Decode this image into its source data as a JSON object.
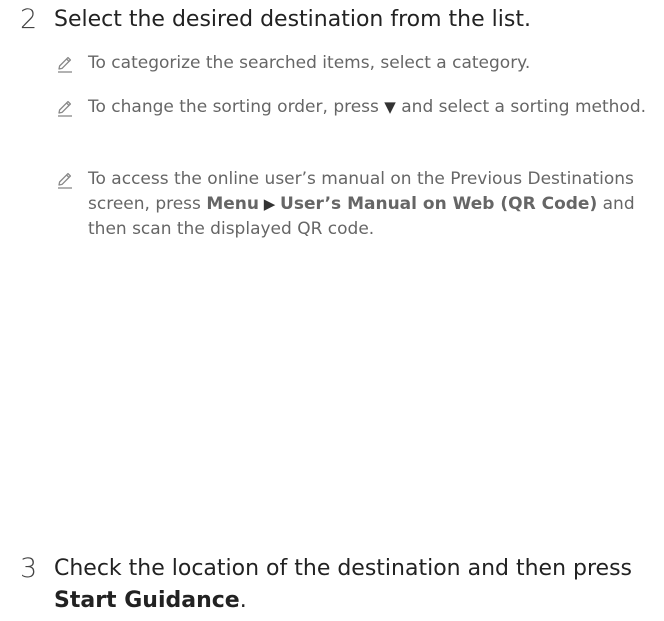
{
  "step2": {
    "number": "2",
    "text": "Select the desired destination from the list."
  },
  "notes": [
    {
      "icon": "pencil-note-icon",
      "text": "To categorize the searched items, select a category."
    },
    {
      "icon": "pencil-note-icon",
      "text_before": "To change the sorting order, press ",
      "symbol": "▼",
      "text_after": " and select a sorting method."
    },
    {
      "icon": "pencil-note-icon",
      "text_before": "To access the online user’s manual on the Previous Destinations screen, press ",
      "bold_menu": "Menu",
      "arrow": " ▶ ",
      "bold_item": "User’s Manual on Web (QR Code)",
      "text_after": " and then scan the displayed QR code."
    }
  ],
  "step3": {
    "number": "3",
    "text_before": "Check the location of the destination and then press ",
    "bold": "Start Guidance",
    "text_after": "."
  }
}
